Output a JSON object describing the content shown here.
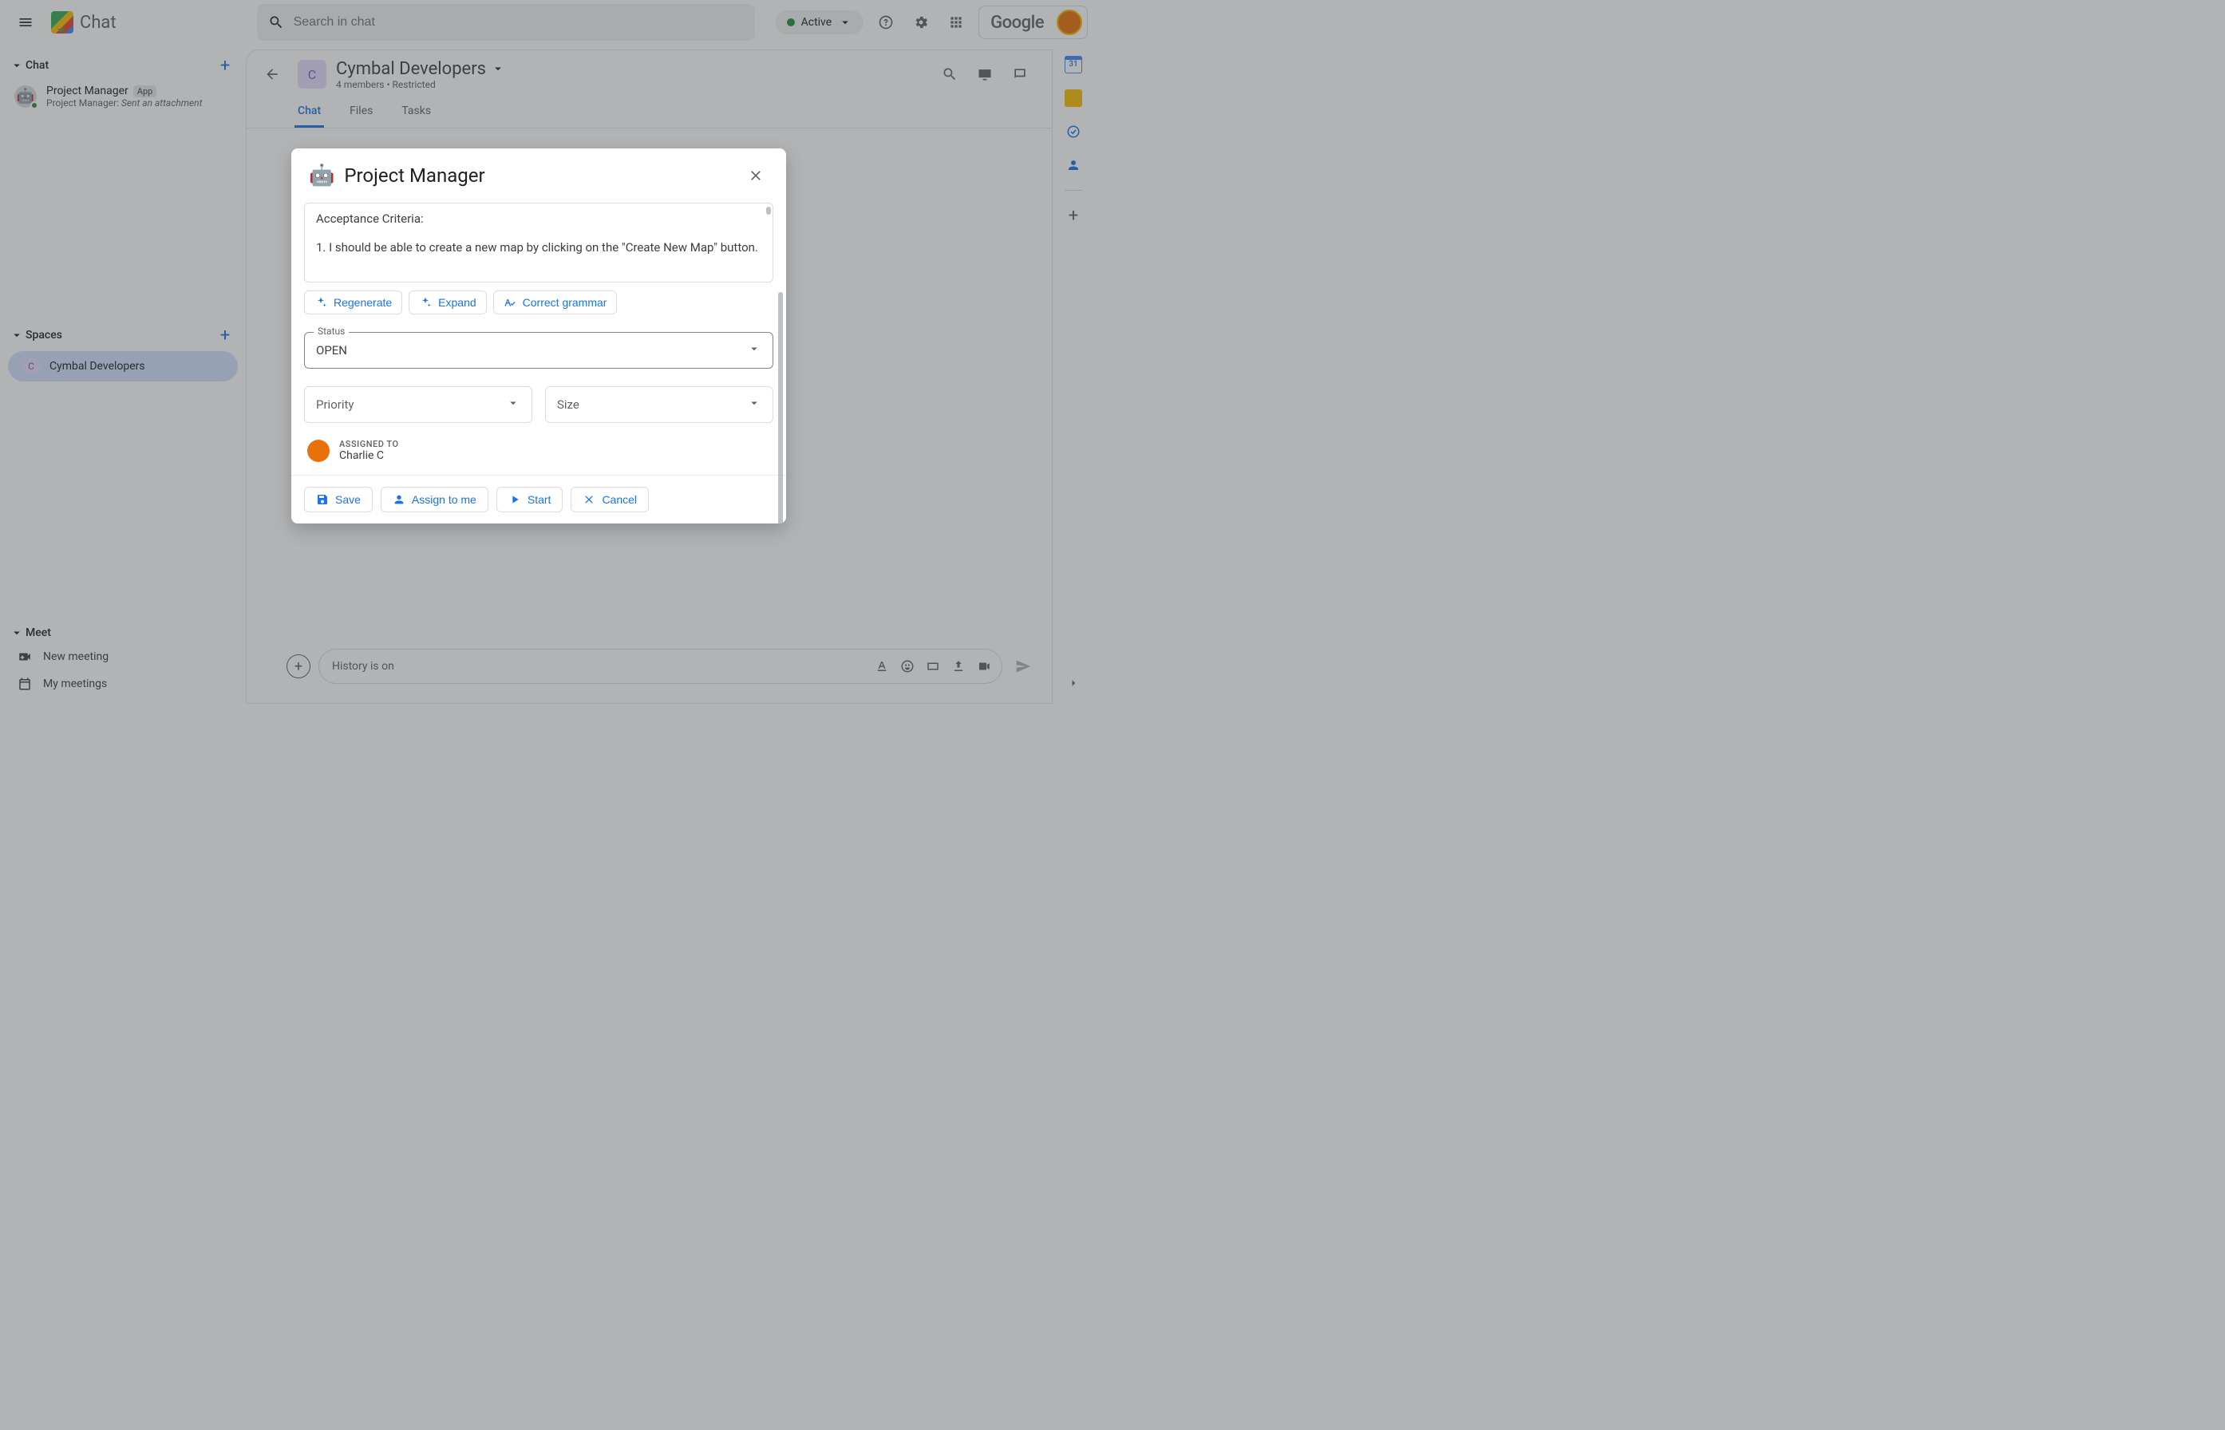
{
  "top": {
    "app_name": "Chat",
    "search_placeholder": "Search in chat",
    "status": "Active",
    "google": "Google"
  },
  "sidebar": {
    "chat_label": "Chat",
    "spaces_label": "Spaces",
    "meet_label": "Meet",
    "pm_item": {
      "name": "Project Manager",
      "badge": "App",
      "preview_prefix": "Project Manager: ",
      "preview_action": "Sent an attachment"
    },
    "space_item": {
      "initial": "C",
      "name": "Cymbal Developers"
    },
    "meet_new": "New meeting",
    "meet_my": "My meetings"
  },
  "header": {
    "initial": "C",
    "title": "Cymbal Developers",
    "members": "4 members",
    "sep": "•",
    "restricted": "Restricted"
  },
  "tabs": {
    "chat": "Chat",
    "files": "Files",
    "tasks": "Tasks"
  },
  "composer": {
    "placeholder": "History is on"
  },
  "rightpanel": {
    "cal_day": "31"
  },
  "dialog": {
    "title": "Project Manager",
    "story_line1": "Acceptance Criteria:",
    "story_line2": "1. I should be able to create a new map by clicking on the \"Create New Map\" button.",
    "btn_regenerate": "Regenerate",
    "btn_expand": "Expand",
    "btn_grammar": "Correct grammar",
    "status_label": "Status",
    "status_value": "OPEN",
    "priority_placeholder": "Priority",
    "size_placeholder": "Size",
    "assigned_label": "ASSIGNED TO",
    "assigned_name": "Charlie C",
    "btn_save": "Save",
    "btn_assign": "Assign to me",
    "btn_start": "Start",
    "btn_cancel": "Cancel"
  }
}
